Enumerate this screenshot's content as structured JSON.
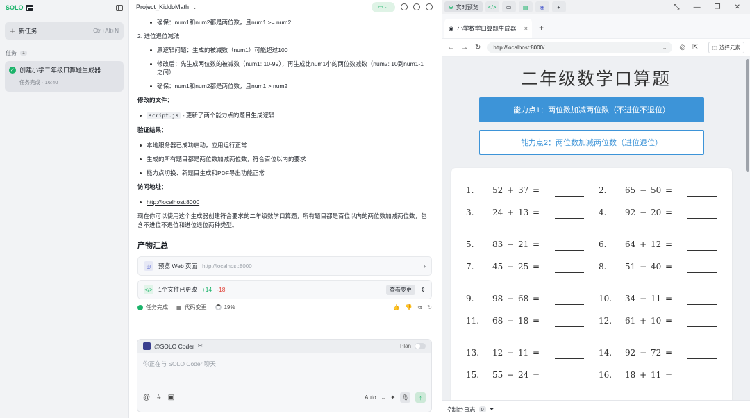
{
  "sidebar": {
    "logo_text": "SOLO",
    "new_task_label": "新任务",
    "new_task_shortcut": "Ctrl+Alt+N",
    "tasks_label": "任务",
    "tasks_count": "1",
    "task": {
      "title": "创建小学二年级口算题生成器",
      "meta": "任务完成 · 16:40"
    }
  },
  "chat": {
    "project_name": "Project_KiddoMath",
    "lines": {
      "ensure1": "确保：num1和num2都是两位数，且num1 >= num2",
      "item2": "2. 进位退位减法",
      "orig": "原逻辑问题：生成的被减数（num1）可能超过100",
      "mod": "修改后：先生成两位数的被减数（num1: 10-99），再生成比num1小的两位数减数（num2: 10到num1-1之间）",
      "ensure2": "确保：num1和num2都是两位数，且num1 > num2",
      "files_heading": "修改的文件：",
      "file_code": "script.js",
      "file_desc": " - 更新了两个能力点的题目生成逻辑",
      "verify_heading": "验证结果：",
      "v1": "本地服务器已成功启动，应用运行正常",
      "v2": "生成的所有题目都是两位数加减两位数，符合百位以内的要求",
      "v3": "能力点切换、新题目生成和PDF导出功能正常",
      "access_heading": "访问地址：",
      "access_url": "http://localhost:8000",
      "summary": "现在你可以使用这个生成器创建符合要求的二年级数学口算题，所有题目都是百位以内的两位数加减两位数，包含不进位不退位和进位退位两种类型。"
    },
    "artifacts_title": "产物汇总",
    "preview_label": "预览 Web 页面",
    "preview_url": "http://localhost:8000",
    "changes_label": "1个文件已更改",
    "changes_add": "+14",
    "changes_del": "-18",
    "view_changes": "查看变更",
    "status_done": "任务完成",
    "status_code": "代码变更",
    "status_percent": "19%",
    "composer": {
      "agent": "@SOLO Coder",
      "plan": "Plan",
      "placeholder": "你正在与 SOLO Coder 聊天",
      "mode": "Auto"
    }
  },
  "browser": {
    "window_tab_live": "实时预览",
    "tab_title": "小学数学口算题生成器",
    "url": "http://localhost:8000/",
    "pick_element": "选择元素",
    "page": {
      "title": "二年级数学口算题",
      "ability1": "能力点1：两位数加减两位数（不进位不退位）",
      "ability2": "能力点2：两位数加减两位数（进位退位）",
      "problems": [
        {
          "n": "1.",
          "expr": "52 + 37 ="
        },
        {
          "n": "2.",
          "expr": "65 − 50 ="
        },
        {
          "n": "3.",
          "expr": "24 + 13 ="
        },
        {
          "n": "4.",
          "expr": "92 − 20 ="
        },
        {
          "n": "5.",
          "expr": "83 − 21 ="
        },
        {
          "n": "6.",
          "expr": "64 + 12 ="
        },
        {
          "n": "7.",
          "expr": "45 − 25 ="
        },
        {
          "n": "8.",
          "expr": "51 − 40 ="
        },
        {
          "n": "9.",
          "expr": "98 − 68 ="
        },
        {
          "n": "10.",
          "expr": "34 − 11 ="
        },
        {
          "n": "11.",
          "expr": "68 − 18 ="
        },
        {
          "n": "12.",
          "expr": "61 + 10 ="
        },
        {
          "n": "13.",
          "expr": "12 − 11 ="
        },
        {
          "n": "14.",
          "expr": "92 − 72 ="
        },
        {
          "n": "15.",
          "expr": "55 − 24 ="
        },
        {
          "n": "16.",
          "expr": "18 + 11 ="
        }
      ]
    },
    "console_label": "控制台日志",
    "console_count": "0"
  }
}
